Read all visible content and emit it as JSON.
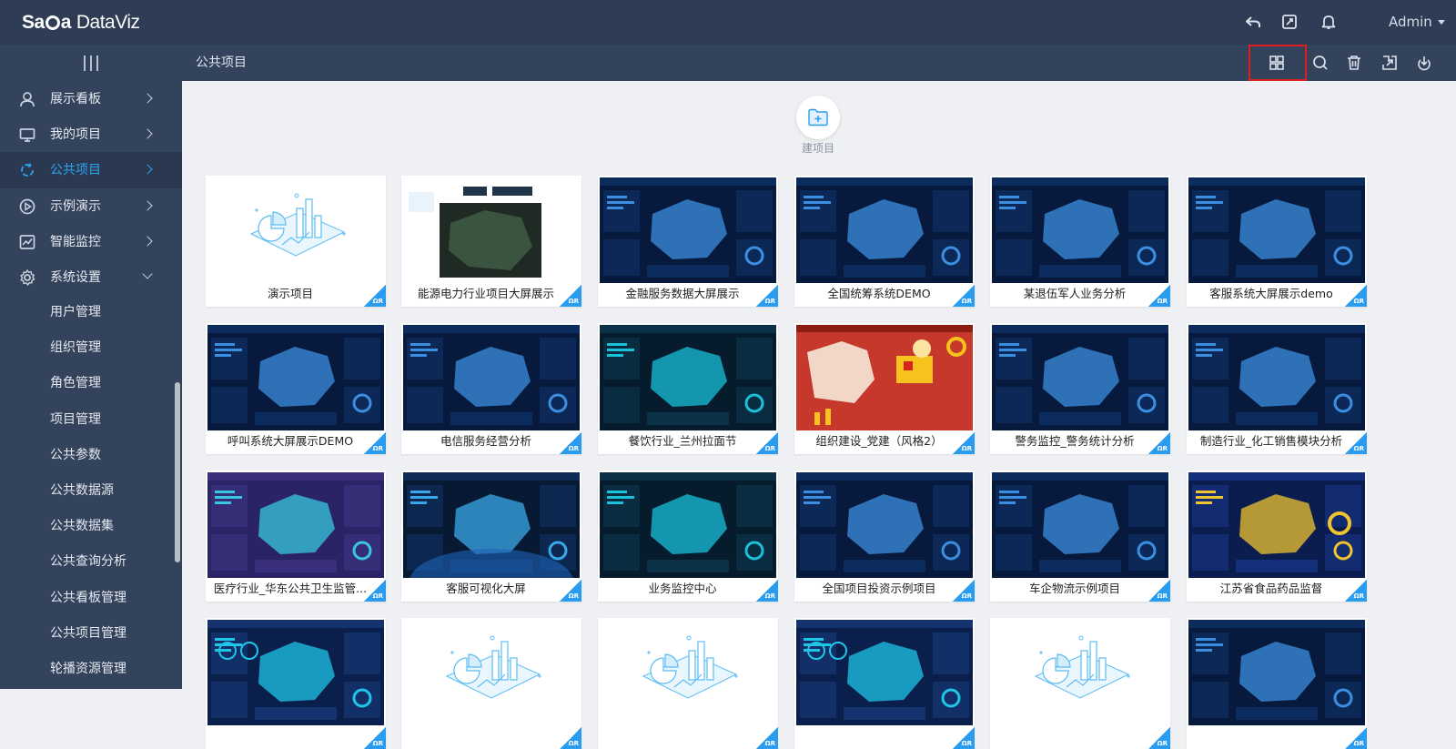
{
  "app": {
    "logo_mark": "Sa",
    "logo_mark2": "a",
    "logo_name": "DataViz"
  },
  "header": {
    "user": "Admin",
    "icons": [
      "undo-icon",
      "edit-window-icon",
      "bell-icon"
    ]
  },
  "subbar": {
    "breadcrumb": "公共项目",
    "tools": [
      "grid-view-icon",
      "search-icon",
      "trash-icon",
      "import-icon",
      "publish-icon"
    ]
  },
  "sidebar": {
    "items": [
      {
        "label": "展示看板",
        "icon": "user-icon"
      },
      {
        "label": "我的项目",
        "icon": "monitor-icon"
      },
      {
        "label": "公共项目",
        "icon": "refresh-icon",
        "active": true
      },
      {
        "label": "示例演示",
        "icon": "play-icon"
      },
      {
        "label": "智能监控",
        "icon": "chart-icon"
      },
      {
        "label": "系统设置",
        "icon": "gear-icon",
        "expanded": true
      }
    ],
    "sub_items": [
      "用户管理",
      "组织管理",
      "角色管理",
      "项目管理",
      "公共参数",
      "公共数据源",
      "公共数据集",
      "公共查询分析",
      "公共看板管理",
      "公共项目管理",
      "轮播资源管理"
    ]
  },
  "main": {
    "new_project_label": "建项目",
    "badge_text": "ΩR",
    "projects": [
      {
        "title": "演示项目",
        "thumb": "blank-illustration"
      },
      {
        "title": "能源电力行业项目大屏展示",
        "thumb": "map-light"
      },
      {
        "title": "金融服务数据大屏展示",
        "thumb": "dark-map"
      },
      {
        "title": "全国统筹系统DEMO",
        "thumb": "dark-map"
      },
      {
        "title": "某退伍军人业务分析",
        "thumb": "dark-map"
      },
      {
        "title": "客服系统大屏展示demo",
        "thumb": "dark-map"
      },
      {
        "title": "呼叫系统大屏展示DEMO",
        "thumb": "dark-map"
      },
      {
        "title": "电信服务经营分析",
        "thumb": "dark-map"
      },
      {
        "title": "餐饮行业_兰州拉面节",
        "thumb": "dark-teal"
      },
      {
        "title": "组织建设_党建（风格2）",
        "thumb": "red"
      },
      {
        "title": "警务监控_警务统计分析",
        "thumb": "dark-map"
      },
      {
        "title": "制造行业_化工销售模块分析",
        "thumb": "dark-map"
      },
      {
        "title": "医疗行业_华东公共卫生监管...",
        "thumb": "purple"
      },
      {
        "title": "客服可视化大屏",
        "thumb": "dark-globe"
      },
      {
        "title": "业务监控中心",
        "thumb": "dark-teal"
      },
      {
        "title": "全国项目投资示例项目",
        "thumb": "dark-map"
      },
      {
        "title": "车企物流示例项目",
        "thumb": "dark-map"
      },
      {
        "title": "江苏省食品药品监督",
        "thumb": "dark-ring"
      },
      {
        "title": "",
        "thumb": "dark-gauges"
      },
      {
        "title": "",
        "thumb": "blank-illustration"
      },
      {
        "title": "",
        "thumb": "blank-illustration"
      },
      {
        "title": "",
        "thumb": "dark-gauges"
      },
      {
        "title": "",
        "thumb": "blank-illustration"
      },
      {
        "title": "",
        "thumb": "dark-map"
      }
    ]
  }
}
